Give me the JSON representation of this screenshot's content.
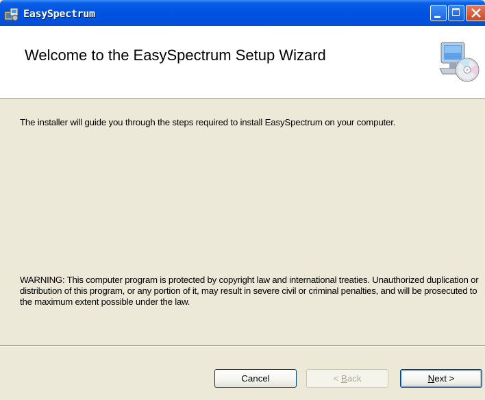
{
  "window": {
    "title": "EasySpectrum",
    "icons": [
      "installer-icon",
      "minimize-icon",
      "maximize-icon",
      "close-icon"
    ]
  },
  "banner": {
    "title": "Welcome to the EasySpectrum Setup Wizard",
    "icon": "computer-cd-icon"
  },
  "body": {
    "intro": "The installer will guide you through the steps required to install EasySpectrum on your computer.",
    "warning": "WARNING: This computer program is protected by copyright law and international treaties. Unauthorized duplication or distribution of this program, or any portion of it, may result in severe civil or criminal penalties, and will be prosecuted to the maximum extent possible under the law."
  },
  "buttons": {
    "cancel": "Cancel",
    "back_prefix": "< ",
    "back_mnemonic": "B",
    "back_rest": "ack",
    "next_mnemonic": "N",
    "next_rest": "ext >"
  },
  "colors": {
    "titlebar": "#0053e1",
    "window_bg": "#ece9d8",
    "banner_bg": "#ffffff"
  }
}
